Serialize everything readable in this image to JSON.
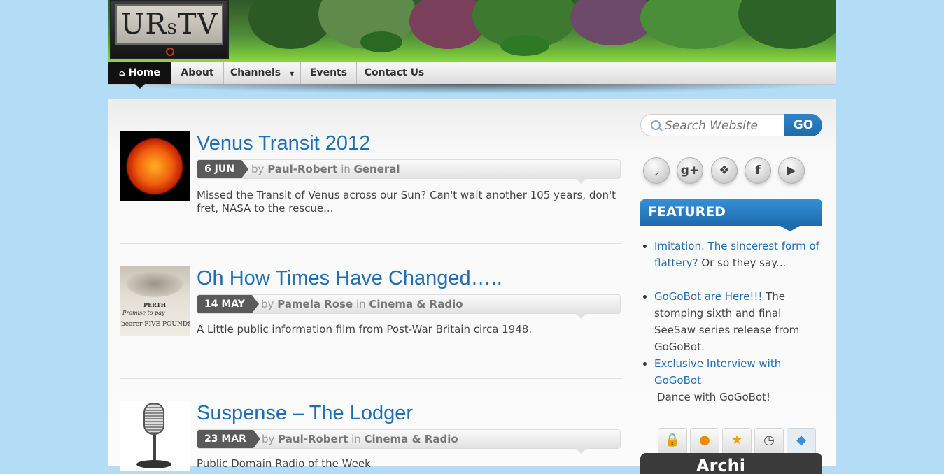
{
  "brand": {
    "logo_text_a": "UR",
    "logo_text_s": "s",
    "logo_text_b": "TV"
  },
  "nav": {
    "items": [
      {
        "label": "Home",
        "icon": "home-icon",
        "active": true
      },
      {
        "label": "About"
      },
      {
        "label": "Channels",
        "has_dropdown": true
      },
      {
        "label": "Events"
      },
      {
        "label": "Contact Us"
      }
    ]
  },
  "posts": [
    {
      "title": "Venus Transit 2012",
      "date": "6 JUN",
      "by": "by",
      "author": "Paul-Robert",
      "in": "in",
      "category": "General",
      "excerpt": "Missed the Transit of Venus across our Sun? Can't wait another 105 years, don't fret, NASA to the rescue..."
    },
    {
      "title": "Oh How Times Have Changed…..",
      "date": "14 MAY",
      "by": "by",
      "author": "Pamela Rose",
      "in": "in",
      "category": "Cinema & Radio",
      "excerpt": "A Little public information film from Post-War Britain circa 1948.",
      "thumb_text_a": "PERTH",
      "thumb_text_b": "Promise to pay",
      "thumb_text_c": "bearer FIVE POUNDS"
    },
    {
      "title": "Suspense – The Lodger",
      "date": "23 MAR",
      "by": "by",
      "author": "Paul-Robert",
      "in": "in",
      "category": "Cinema & Radio",
      "excerpt": "Public Domain Radio of the Week"
    }
  ],
  "sidebar": {
    "search_placeholder": "Search Website",
    "go_label": "GO",
    "social": [
      {
        "icon": "rss-icon",
        "glyph": "◞"
      },
      {
        "icon": "google-plus-icon",
        "glyph": "g+"
      },
      {
        "icon": "twitter-icon",
        "glyph": "❖"
      },
      {
        "icon": "facebook-icon",
        "glyph": "f"
      },
      {
        "icon": "youtube-icon",
        "glyph": "▶"
      }
    ],
    "featured_title": "FEATURED",
    "featured": [
      {
        "link": "Imitation. The sincerest form of flattery?",
        "text": "Or so they say..."
      },
      {
        "link": "GoGoBot are Here!!!",
        "text": "The stomping sixth and final SeeSaw series release from GoGoBot."
      },
      {
        "link": "Exclusive Interview with GoGoBot",
        "text": "Dance with GoGoBot!"
      }
    ],
    "tabs": [
      {
        "icon": "lock-icon",
        "glyph": "🔒"
      },
      {
        "icon": "comment-icon",
        "glyph": "●"
      },
      {
        "icon": "star-icon",
        "glyph": "★"
      },
      {
        "icon": "clock-icon",
        "glyph": "◷"
      },
      {
        "icon": "tag-icon",
        "glyph": "◆"
      }
    ],
    "archive_partial": "Archi"
  },
  "colors": {
    "link": "#1f6fb2",
    "featured_bg": "#1e6aad",
    "page_bg": "#b3dcf6"
  }
}
